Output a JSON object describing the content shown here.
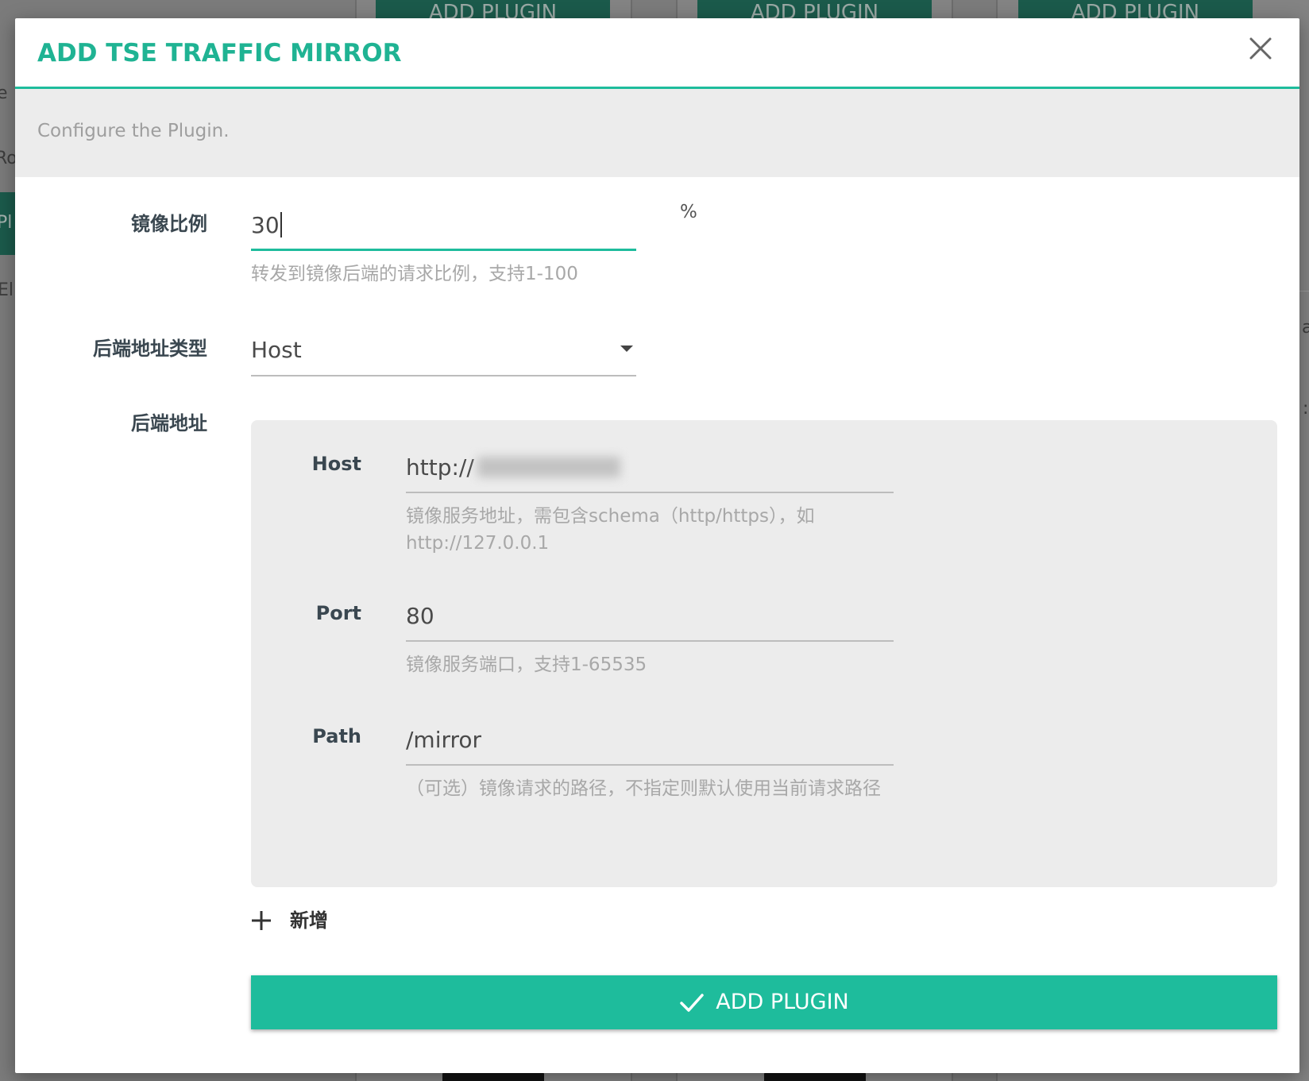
{
  "background": {
    "top_buttons": [
      "ADD PLUGIN",
      "ADD PLUGIN",
      "ADD PLUGIN"
    ],
    "left_fragments": [
      "e",
      "Ro",
      "Pl",
      "Eli"
    ],
    "right_fragments": [
      "a",
      ":"
    ]
  },
  "modal": {
    "title": "ADD TSE TRAFFIC MIRROR",
    "close_icon": "close-icon",
    "description": "Configure the Plugin.",
    "ratio": {
      "label": "镜像比例",
      "value": "30",
      "unit": "%",
      "hint": "转发到镜像后端的请求比例，支持1-100"
    },
    "backend_type": {
      "label": "后端地址类型",
      "selected": "Host",
      "icon": "caret-down-icon"
    },
    "backend": {
      "label": "后端地址",
      "host": {
        "label": "Host",
        "value": "http://",
        "hint": "镜像服务地址，需包含schema（http/https），如http://127.0.0.1"
      },
      "port": {
        "label": "Port",
        "value": "80",
        "hint": "镜像服务端口，支持1-65535"
      },
      "path": {
        "label": "Path",
        "value": "/mirror",
        "hint": "（可选）镜像请求的路径，不指定则默认使用当前请求路径"
      }
    },
    "add_row": {
      "icon": "plus-icon",
      "label": "新增"
    },
    "submit": {
      "icon": "check-icon",
      "label": "ADD PLUGIN"
    }
  },
  "colors": {
    "accent": "#1ebc9c",
    "title": "#1fb393",
    "overlay": "#7b7b7b",
    "panel": "#ececec",
    "label": "#3a4750",
    "hint": "#a8a8a8"
  }
}
